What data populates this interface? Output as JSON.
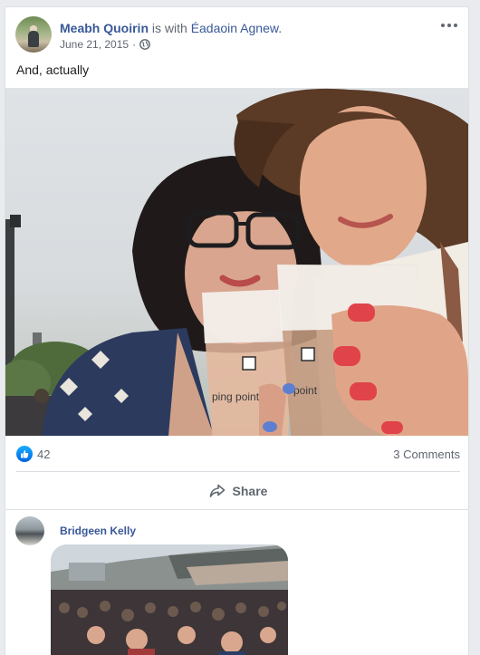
{
  "post": {
    "author": "Meabh Quoirin",
    "with_text": "is with",
    "tagged": "Éadaoin Agnew.",
    "date": "June 21, 2015",
    "separator": "·",
    "privacy_icon": "globe-icon",
    "body": "And, actually"
  },
  "photo": {
    "description_icon": "photo",
    "cup_text_left": "ping point",
    "cup_text_right": "point"
  },
  "reactions": {
    "like_count": "42",
    "comments_label": "3 Comments"
  },
  "actions": {
    "share_label": "Share"
  },
  "comment": {
    "author": "Bridgeen Kelly"
  },
  "colors": {
    "link": "#385898",
    "secondary_text": "#606770",
    "like_blue": "#1877f2"
  }
}
